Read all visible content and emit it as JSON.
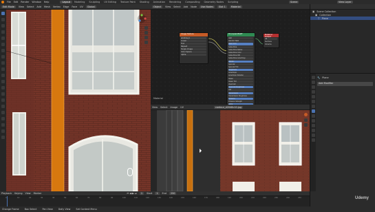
{
  "topbar": {
    "menu": [
      "File",
      "Edit",
      "Render",
      "Window",
      "Help"
    ],
    "workspaces": [
      "Layout",
      "Modeling",
      "Sculpting",
      "UV Editing",
      "Texture Paint",
      "Shading",
      "Animation",
      "Rendering",
      "Compositing",
      "Geometry Nodes",
      "Scripting"
    ],
    "active_workspace": "Layout",
    "scene": "Scene",
    "view_layer": "View Layer"
  },
  "viewport": {
    "mode": "Edit Mode",
    "menus": [
      "View",
      "Select",
      "Add",
      "Mesh",
      "Vertex",
      "Edge",
      "Face",
      "UV"
    ],
    "shading_label": "Global"
  },
  "node_editor": {
    "editor_menus": [
      "Object",
      "View",
      "Select",
      "Add",
      "Node"
    ],
    "use_nodes_label": "Use Nodes",
    "slot_label": "Slot 1",
    "material_name": "Material",
    "frame_label": "Material",
    "image_node_title": "Image Texture",
    "image_node_file": "window_b",
    "image_node_fields": [
      "Linear",
      "Flat",
      "Repeat",
      "Single Image",
      "Color Space",
      "Alpha"
    ],
    "bsdf_title": "Principled BSDF",
    "bsdf_rows": [
      "GGX",
      "Random Walk",
      "Base Color",
      "Subsurface",
      "Subsurface Radius",
      "Subsurface Color",
      "Subsurface IOR",
      "Subsurface Anisotropy",
      "Metallic",
      "Specular",
      "Specular Tint",
      "Roughness",
      "Anisotropic",
      "Anisotropic Rotation",
      "Sheen",
      "Sheen Tint",
      "Clearcoat",
      "Clearcoat Roughness",
      "IOR",
      "Transmission",
      "Transmission Roughness",
      "Emission",
      "Emission Strength",
      "Alpha",
      "Normal",
      "Clearcoat Normal",
      "Tangent"
    ],
    "output_title": "Material Output",
    "output_rows": [
      "All",
      "Surface",
      "Volume",
      "Displacement"
    ]
  },
  "uv_editor": {
    "menus": [
      "View",
      "Select",
      "Image",
      "UV"
    ],
    "image_name": "contour_d2048c10.jpg"
  },
  "outliner": {
    "title": "Scene Collection",
    "rows": [
      "Collection",
      "Plane"
    ]
  },
  "properties": {
    "object_name": "Plane",
    "modifier_label": "Add Modifier"
  },
  "timeline": {
    "menus": [
      "Playback",
      "Keying",
      "View",
      "Marker"
    ],
    "ticks": [
      "0",
      "10",
      "20",
      "30",
      "40",
      "50",
      "60",
      "70",
      "80",
      "90",
      "100",
      "110",
      "120",
      "130",
      "140",
      "150",
      "160",
      "170",
      "180",
      "190",
      "200",
      "210",
      "220",
      "230",
      "240",
      "250"
    ],
    "current_frame": "1",
    "start_label": "Start",
    "start": "1",
    "end_label": "End",
    "end": "250"
  },
  "statusbar": {
    "items": [
      "Change Frame",
      "Box Select",
      "Pan View",
      "Dolly View",
      "Set Context Menu"
    ]
  },
  "watermark": "Udemy",
  "colors": {
    "accent_blue": "#4a72b0",
    "orange_selection": "#e8820e",
    "brick": "#7b3a2b",
    "image_node_header": "#c65b26",
    "bsdf_header": "#2f8a52",
    "output_header": "#b33030"
  }
}
